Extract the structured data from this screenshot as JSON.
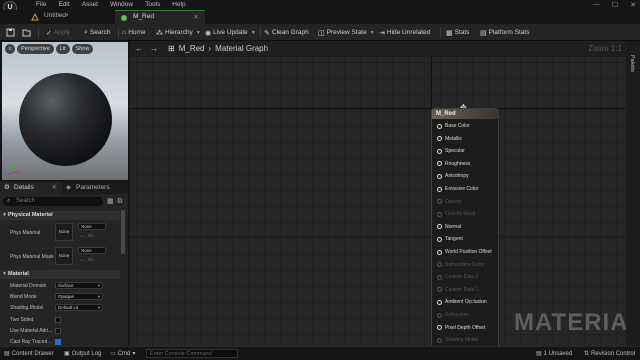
{
  "menu": {
    "logo": "U",
    "items": [
      "File",
      "Edit",
      "Asset",
      "Window",
      "Tools",
      "Help"
    ],
    "window_controls": [
      "—",
      "☐",
      "✕"
    ]
  },
  "tabs": [
    {
      "label": "Untitled•",
      "close": "✕"
    },
    {
      "label": "M_Red",
      "close": "✕"
    }
  ],
  "toolbar": {
    "save": "",
    "browse": "",
    "apply": "Apply",
    "search": "Search",
    "home": "Home",
    "hierarchy": "Hierarchy",
    "live_update": "Live Update",
    "clean_graph": "Clean Graph",
    "preview_state": "Preview State",
    "hide_unrelated": "Hide Unrelated",
    "stats": "Stats",
    "platform_stats": "Platform Stats"
  },
  "viewport": {
    "perspective": "Perspective",
    "lit": "Lit",
    "show": "Show"
  },
  "panel_tabs": {
    "details": "Details",
    "parameters": "Parameters"
  },
  "details": {
    "search_placeholder": "Search",
    "physical_material": {
      "header": "Physical Material",
      "phys_material": {
        "label": "Phys Material",
        "thumb": "None",
        "value": "None"
      },
      "phys_material_mask": {
        "label": "Phys Material Mask",
        "thumb": "None",
        "value": "None"
      }
    },
    "material": {
      "header": "Material",
      "rows": [
        {
          "label": "Material Domain",
          "value": "Surface"
        },
        {
          "label": "Blend Mode",
          "value": "Opaque"
        },
        {
          "label": "Shading Model",
          "value": "Default Lit"
        }
      ],
      "two_sided": "Two Sided",
      "use_material_attr": "Use Material Attri...",
      "cast_ray_traced": "Cast Ray Traced..."
    }
  },
  "graph": {
    "breadcrumb_root": "M_Red",
    "breadcrumb_sep": "›",
    "breadcrumb_leaf": "Material Graph",
    "zoom": "Zoom 1:1",
    "watermark": "MATERIAL",
    "node": {
      "title": "M_Red",
      "pins": [
        {
          "label": "Base Color",
          "enabled": true
        },
        {
          "label": "Metallic",
          "enabled": true
        },
        {
          "label": "Specular",
          "enabled": true
        },
        {
          "label": "Roughness",
          "enabled": true
        },
        {
          "label": "Anisotropy",
          "enabled": true
        },
        {
          "label": "Emissive Color",
          "enabled": true
        },
        {
          "label": "Opacity",
          "enabled": false
        },
        {
          "label": "Opacity Mask",
          "enabled": false
        },
        {
          "label": "Normal",
          "enabled": true
        },
        {
          "label": "Tangent",
          "enabled": true
        },
        {
          "label": "World Position Offset",
          "enabled": true
        },
        {
          "label": "Subsurface Color",
          "enabled": false
        },
        {
          "label": "Custom Data 0",
          "enabled": false
        },
        {
          "label": "Custom Data 1",
          "enabled": false
        },
        {
          "label": "Ambient Occlusion",
          "enabled": true
        },
        {
          "label": "Refraction",
          "enabled": false
        },
        {
          "label": "Pixel Depth Offset",
          "enabled": true
        },
        {
          "label": "Shading Model",
          "enabled": false
        }
      ]
    }
  },
  "palette": {
    "label": "Palette"
  },
  "statusbar": {
    "content_drawer": "Content Drawer",
    "output_log": "Output Log",
    "cmd": "Cmd",
    "console_placeholder": "Enter Console Command",
    "unsaved": "1 Unsaved",
    "revision_control": "Revision Control"
  },
  "colors": {
    "accent_green": "#2e7d32",
    "node_header": "#6b5e50",
    "background": "#262626"
  }
}
